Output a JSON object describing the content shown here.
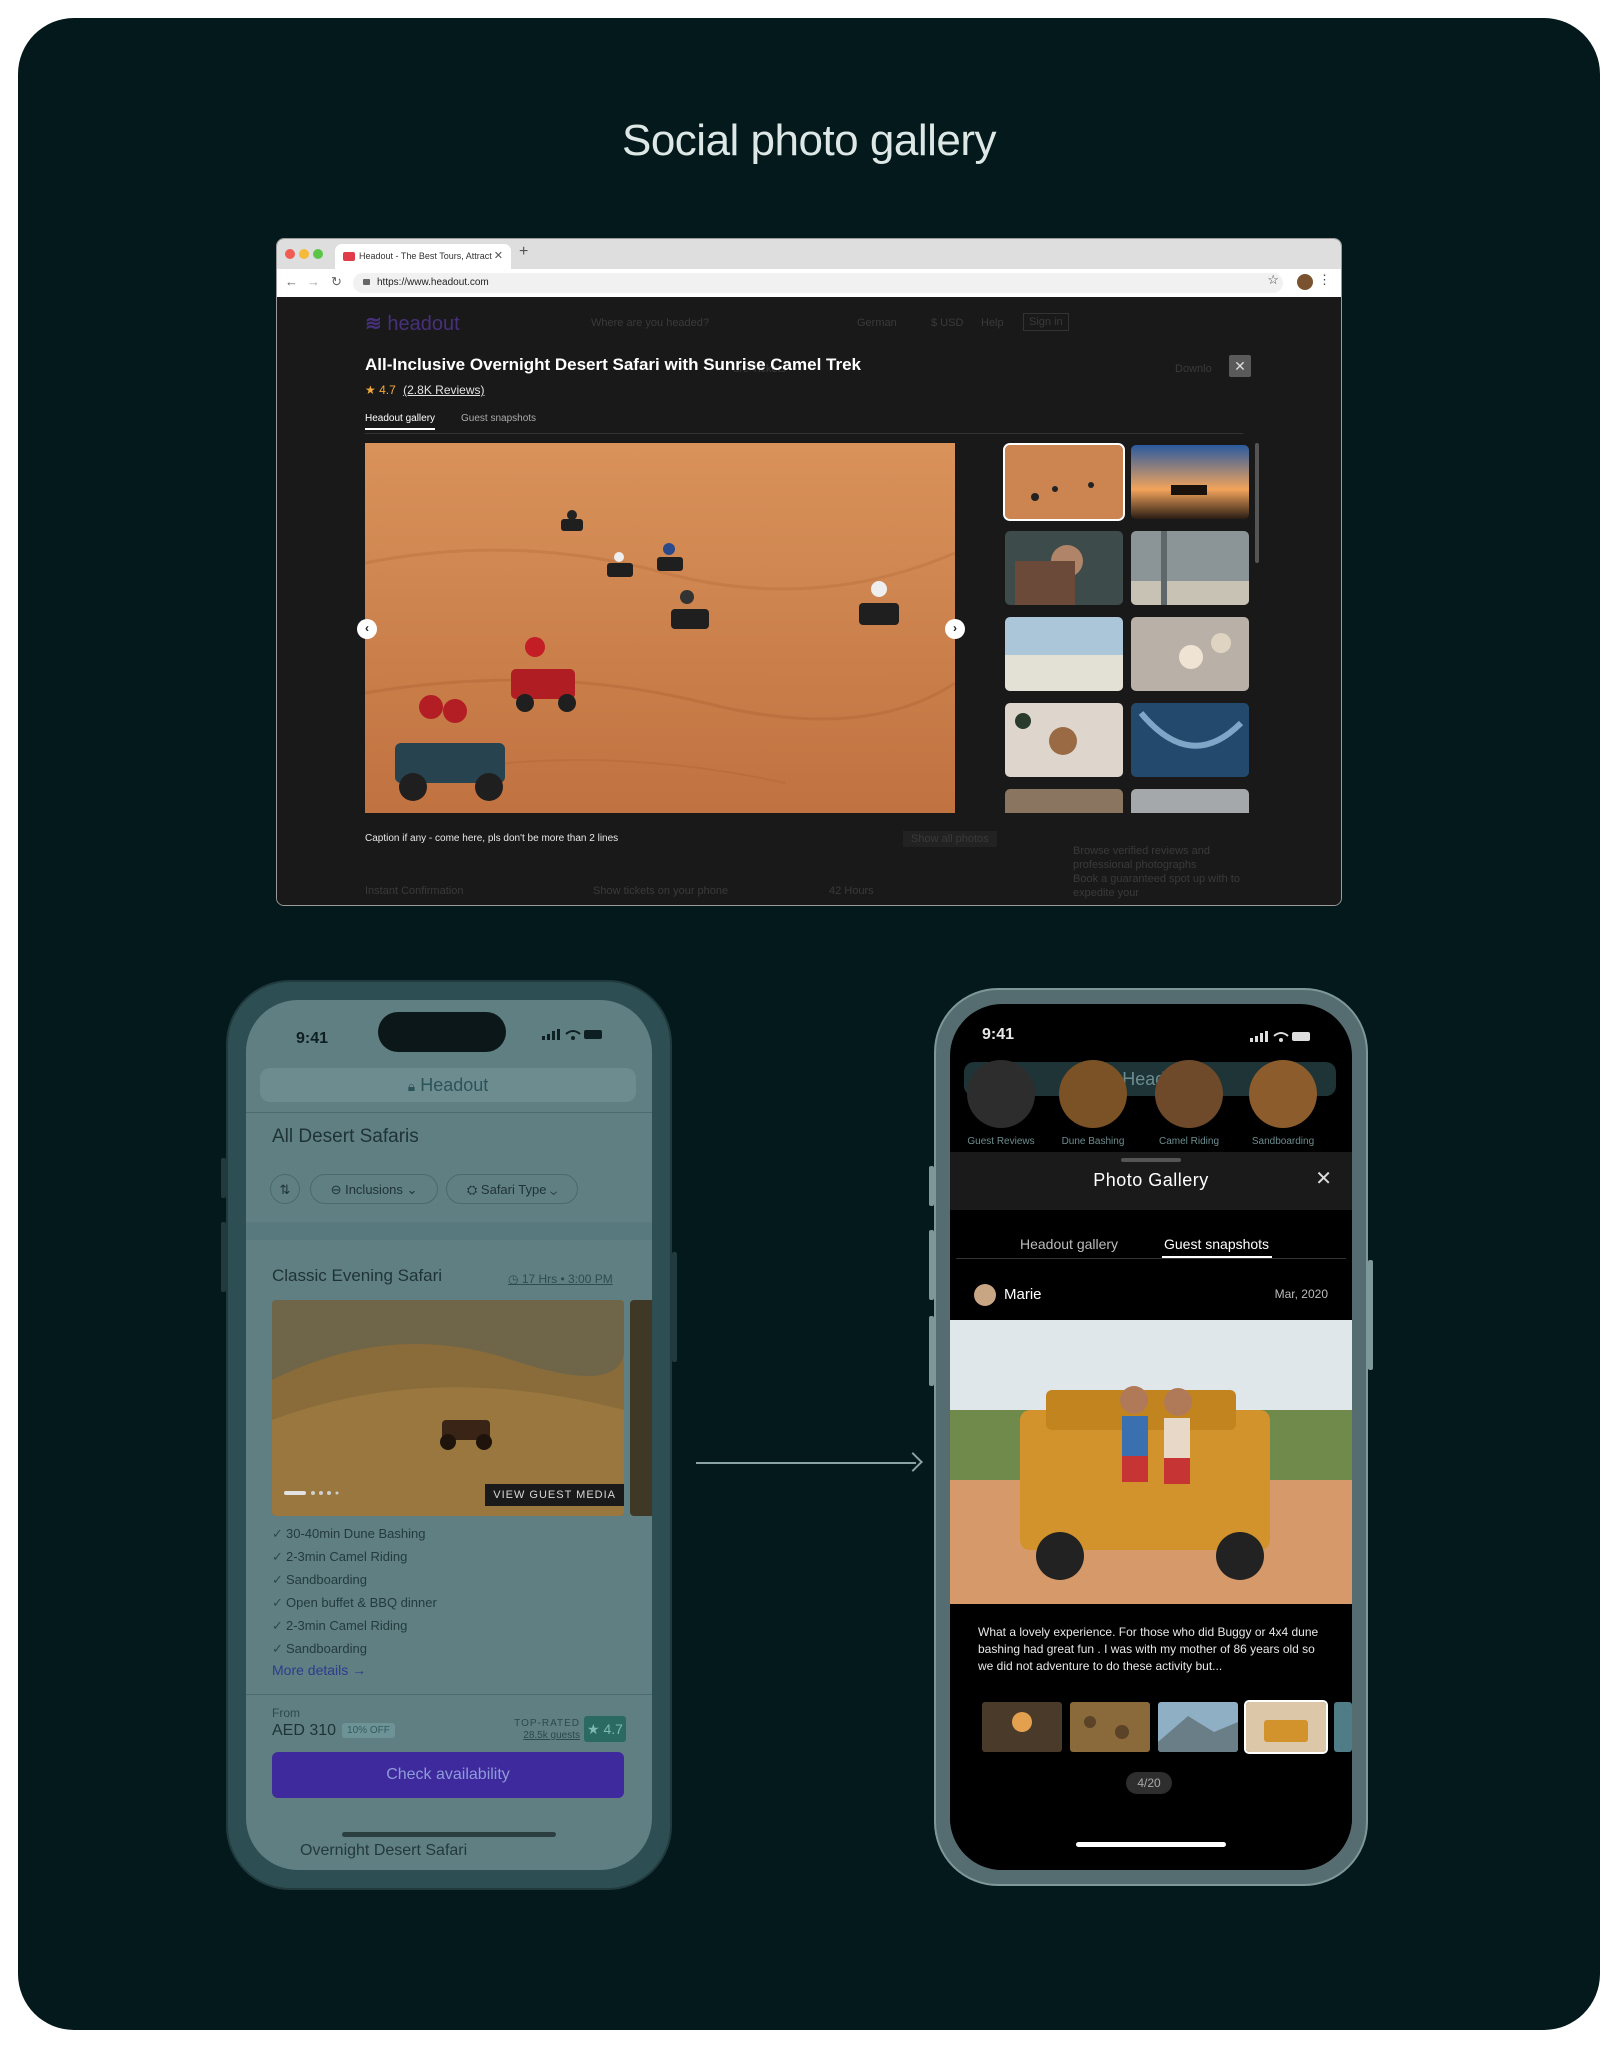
{
  "headline": "Social photo gallery",
  "browser": {
    "tab_title": "Headout - The Best Tours, Attract",
    "url": "https://www.headout.com",
    "logo_text": "headout",
    "ghost": {
      "search": "Where are you headed?",
      "language": "German",
      "currency": "$ USD",
      "help": "Help",
      "signin": "Sign in",
      "tickets": "ure Tickets",
      "download": "Downlo",
      "show_all": "Show all photos",
      "bullet_1": "Browse verified reviews and",
      "bullet_2": "professional photographs",
      "bullet_3": "Book a guaranteed spot up with to",
      "bullet_4": "expedite your",
      "bar_1": "Instant Confirmation",
      "bar_2": "Show tickets on your phone",
      "bar_3": "42 Hours"
    },
    "title": "All-Inclusive Overnight Desert Safari with Sunrise Camel Trek",
    "rating_value": "4.7",
    "reviews_label": "(2.8K Reviews)",
    "gallery_tabs": [
      "Headout gallery",
      "Guest snapshots"
    ],
    "caption": "Caption if any - come here, pls don't be more than 2 lines"
  },
  "left_phone": {
    "time": "9:41",
    "url": "Headout",
    "heading": "All Desert Safaris",
    "chips": [
      "Inclusions",
      "Safari Type"
    ],
    "card_title": "Classic Evening Safari",
    "duration": "17 Hrs • 3:00 PM",
    "media_button": "VIEW GUEST MEDIA",
    "inclusions": [
      "30-40min Dune Bashing",
      "2-3min Camel Riding",
      "Sandboarding",
      "Open buffet & BBQ dinner",
      "2-3min Camel Riding",
      "Sandboarding"
    ],
    "more_details": "More details",
    "from_label": "From",
    "price": "AED 310",
    "discount": "10% OFF",
    "top_rated": "TOP-RATED",
    "guests": "28.5k guests",
    "rating": "4.7",
    "cta": "Check availability",
    "footer_ghost": "Overnight Desert Safari"
  },
  "right_phone": {
    "time": "9:41",
    "url": "Headout",
    "categories": [
      "Guest Reviews",
      "Dune Bashing",
      "Camel Riding",
      "Sandboarding"
    ],
    "sheet_title": "Photo Gallery",
    "tabs": [
      "Headout gallery",
      "Guest snapshots"
    ],
    "user": "Marie",
    "date": "Mar, 2020",
    "review": "What a lovely experience. For those who did Buggy or 4x4 dune bashing had great fun . I was with my mother of 86 years old so we did not adventure to do these activity but...",
    "counter": "4/20"
  },
  "icons": {
    "close": "close-icon",
    "star": "star-icon",
    "lock": "lock-icon",
    "check": "check-icon",
    "chevron": "chevron-right-icon"
  },
  "colors": {
    "board": "#04191b",
    "brand_purple": "#3e2a9c",
    "rating_orange": "#f2a93b",
    "rating_badge": "#2a6a62"
  }
}
